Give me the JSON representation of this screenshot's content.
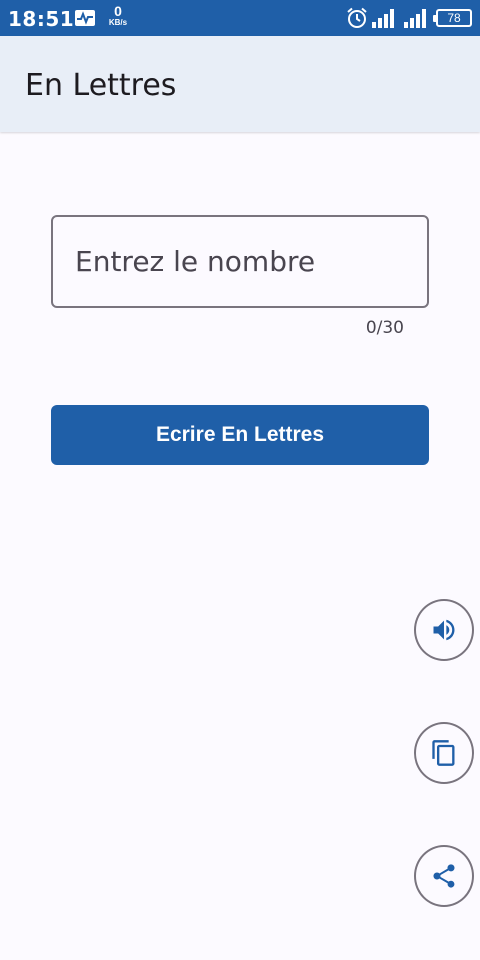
{
  "status_bar": {
    "time": "18:51",
    "net_speed_value": "0",
    "net_speed_unit": "KB/s",
    "battery_level": "78",
    "icons": [
      "pulse-icon",
      "alarm-icon",
      "signal-icon",
      "signal-icon",
      "battery-icon"
    ]
  },
  "app_bar": {
    "title": "En Lettres"
  },
  "number_input": {
    "placeholder": "Entrez le nombre",
    "value": "",
    "counter": "0/30"
  },
  "convert_button": {
    "label": "Ecrire En Lettres"
  },
  "actions": [
    {
      "icon": "volume-icon"
    },
    {
      "icon": "copy-icon"
    },
    {
      "icon": "share-icon"
    }
  ],
  "colors": {
    "primary": "#1f5fa8",
    "app_bar_background": "#e8eef7",
    "page_background": "#fcfaff",
    "outline": "#79747e"
  }
}
